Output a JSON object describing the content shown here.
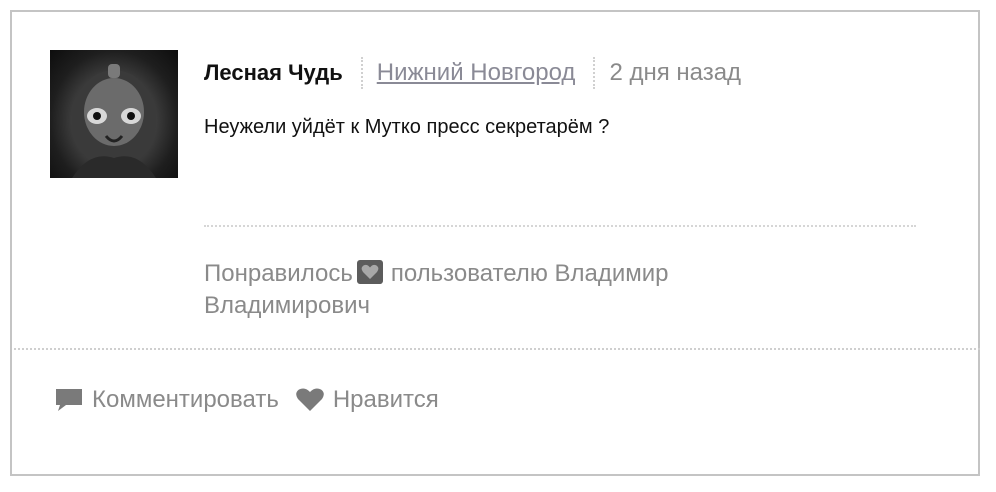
{
  "post": {
    "author": "Лесная Чудь",
    "city": "Нижний Новгород",
    "time": "2 дня назад",
    "message": "Неужели уйдёт к Мутко пресс секретарём ?",
    "liked_prefix": "Понравилось",
    "liked_suffix": "пользователю Владимир Владимирович"
  },
  "actions": {
    "comment_label": "Комментировать",
    "like_label": "Нравится"
  },
  "colors": {
    "border": "#c4c4c4",
    "muted_text": "#8a8a8a",
    "link": "#8a8a96",
    "icon": "#7a7a7a"
  }
}
